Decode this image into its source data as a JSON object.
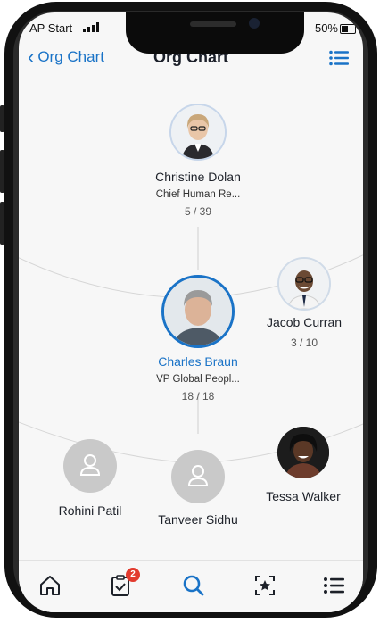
{
  "status_bar": {
    "carrier": "AP Start",
    "battery": "50%"
  },
  "nav": {
    "back_label": "Org Chart",
    "title": "Org Chart"
  },
  "manager": {
    "name": "Christine Dolan",
    "role": "Chief Human Re...",
    "count": "5 / 39"
  },
  "focus": {
    "name": "Charles Braun",
    "role": "VP Global Peopl...",
    "count": "18 / 18"
  },
  "peer": {
    "name": "Jacob Curran",
    "count": "3 / 10"
  },
  "reports": [
    {
      "name": "Rohini Patil"
    },
    {
      "name": "Tanveer Sidhu"
    },
    {
      "name": "Tessa Walker"
    }
  ],
  "tabbar": {
    "items": [
      "home-icon",
      "approvals-icon",
      "search-icon",
      "favorites-icon",
      "menu-icon"
    ],
    "badge": "2"
  },
  "colors": {
    "accent": "#1a73c7",
    "badge": "#e23a2e",
    "placeholder": "#c9c9c9"
  }
}
